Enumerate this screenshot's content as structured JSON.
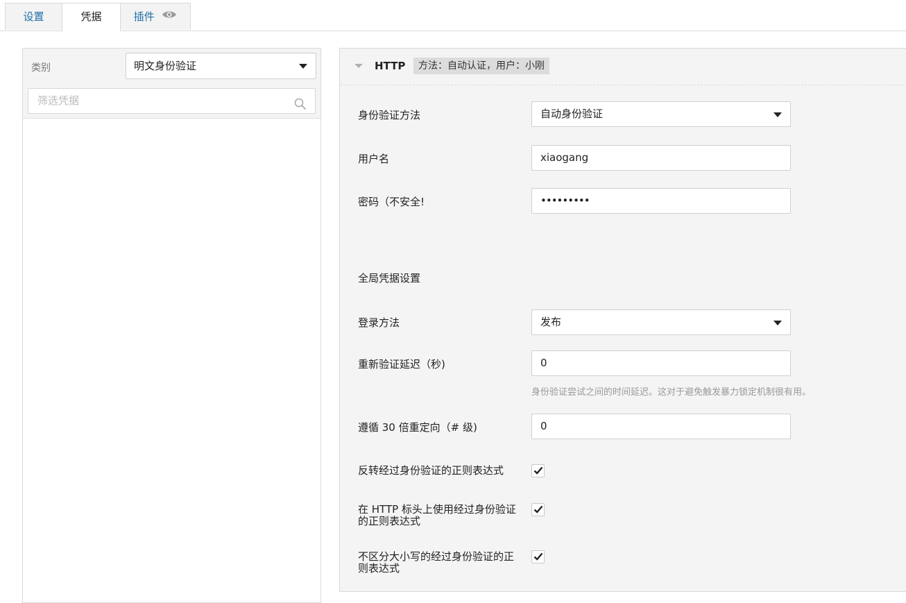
{
  "tabs": {
    "settings": "设置",
    "credentials": "凭据",
    "plugins": "插件"
  },
  "left": {
    "category_label": "类别",
    "category_value": "明文身份验证",
    "filter_placeholder": "筛选凭据"
  },
  "right": {
    "section_title": "HTTP",
    "summary": "方法：自动认证，用户：小刚",
    "auth_method_label": "身份验证方法",
    "auth_method_value": "自动身份验证",
    "username_label": "用户名",
    "username_value": "xiaogang",
    "password_label": "密码（不安全!",
    "password_value": "•••••••••",
    "global_title": "全局凭据设置",
    "login_method_label": "登录方法",
    "login_method_value": "发布",
    "reauth_delay_label": "重新验证延迟（秒)",
    "reauth_delay_value": "0",
    "reauth_delay_help": "身份验证尝试之间的时间延迟。这对于避免触发暴力锁定机制很有用。",
    "follow_redirects_label": "遵循 30 倍重定向（# 级)",
    "follow_redirects_value": "0",
    "invert_regex_label": "反转经过身份验证的正则表达式",
    "invert_regex_checked": true,
    "http_header_regex_label": "在 HTTP 标头上使用经过身份验证的正则表达式",
    "http_header_regex_checked": true,
    "case_insensitive_label": "不区分大小写的经过身份验证的正则表达式",
    "case_insensitive_checked": true
  },
  "colors": {
    "link_blue": "#1f6fa8",
    "panel_gray": "#f4f4f4",
    "badge_gray": "#dcdcdc",
    "help_gray": "#999999"
  }
}
